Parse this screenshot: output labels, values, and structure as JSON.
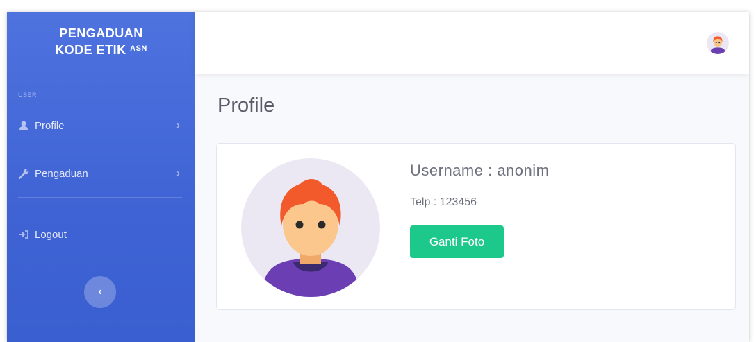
{
  "sidebar": {
    "brand_line1": "PENGADUAN",
    "brand_line2": "KODE ETIK",
    "brand_sup": "ASN",
    "heading": "USER",
    "items": [
      {
        "label": "Profile",
        "icon": "user-icon"
      },
      {
        "label": "Pengaduan",
        "icon": "wrench-icon"
      }
    ],
    "logout_label": "Logout",
    "toggle_icon": "chevron-left-icon",
    "toggle_symbol": "‹"
  },
  "topbar": {
    "avatar_icon": "user-avatar-icon"
  },
  "page": {
    "title": "Profile"
  },
  "profile": {
    "username": "Username : anonim",
    "telp": "Telp : 123456",
    "change_photo_label": "Ganti Foto"
  },
  "colors": {
    "sidebar": "#4e73df",
    "success": "#1cc88a",
    "background": "#f8f9fc",
    "text": "#5a5c69"
  }
}
